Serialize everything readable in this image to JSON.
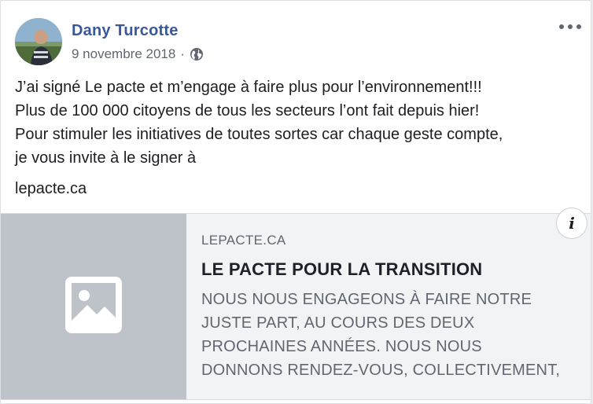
{
  "post": {
    "author": "Dany Turcotte",
    "date": "9 novembre 2018",
    "separator": "·",
    "privacy_icon": "globe-icon",
    "more_icon": "ellipsis-icon",
    "paragraphs": [
      "J’ai signé Le pacte et m’engage à faire plus pour l’environnement!!!",
      "Plus de 100 000 citoyens de tous les secteurs l’ont fait depuis hier!",
      "Pour stimuler les initiatives de toutes sortes car chaque geste compte,",
      "je vous invite à le signer à"
    ],
    "link_text": "lepacte.ca"
  },
  "link_preview": {
    "domain": "LEPACTE.CA",
    "title": "LE PACTE POUR LA TRANSITION",
    "description_lines": [
      "NOUS NOUS ENGAGEONS À FAIRE NOTRE",
      "JUSTE PART, AU COURS DES DEUX",
      "PROCHAINES ANNÉES. NOUS NOUS",
      "DONNONS RENDEZ-VOUS, COLLECTIVEMENT,"
    ],
    "info_label": "i",
    "image_icon": "image-placeholder-icon"
  },
  "colors": {
    "author": "#385898",
    "text": "#1c1e21",
    "secondary": "#606770",
    "placeholder_bg": "#bec3c9"
  }
}
